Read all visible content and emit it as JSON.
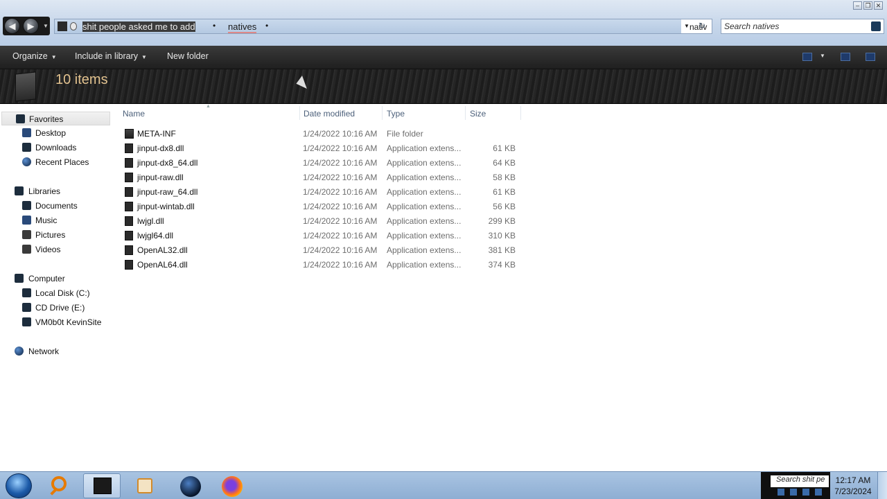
{
  "window": {
    "controls": {
      "minimize": "–",
      "restore": "❐",
      "close": "✕"
    }
  },
  "address": {
    "crumbs": [
      "shit people asked me to add",
      "natives"
    ],
    "end_text": "nativ",
    "refresh_icon": "refresh-icon"
  },
  "search": {
    "placeholder": "Search natives"
  },
  "toolbar": {
    "organize": "Organize",
    "include": "Include in library",
    "new_folder": "New folder"
  },
  "header": {
    "item_count": "10 items"
  },
  "nav": {
    "favorites": {
      "label": "Favorites",
      "items": [
        "Desktop",
        "Downloads",
        "Recent Places"
      ]
    },
    "libraries": {
      "label": "Libraries",
      "items": [
        "Documents",
        "Music",
        "Pictures",
        "Videos"
      ]
    },
    "computer": {
      "label": "Computer",
      "items": [
        "Local Disk (C:)",
        "CD Drive (E:)",
        "VM0b0t KevinSite"
      ]
    },
    "network": {
      "label": "Network"
    }
  },
  "columns": {
    "name": "Name",
    "date": "Date modified",
    "type": "Type",
    "size": "Size"
  },
  "files": [
    {
      "name": "META-INF",
      "date": "1/24/2022 10:16 AM",
      "type": "File folder",
      "size": ""
    },
    {
      "name": "jinput-dx8.dll",
      "date": "1/24/2022 10:16 AM",
      "type": "Application extens...",
      "size": "61 KB"
    },
    {
      "name": "jinput-dx8_64.dll",
      "date": "1/24/2022 10:16 AM",
      "type": "Application extens...",
      "size": "64 KB"
    },
    {
      "name": "jinput-raw.dll",
      "date": "1/24/2022 10:16 AM",
      "type": "Application extens...",
      "size": "58 KB"
    },
    {
      "name": "jinput-raw_64.dll",
      "date": "1/24/2022 10:16 AM",
      "type": "Application extens...",
      "size": "61 KB"
    },
    {
      "name": "jinput-wintab.dll",
      "date": "1/24/2022 10:16 AM",
      "type": "Application extens...",
      "size": "56 KB"
    },
    {
      "name": "lwjgl.dll",
      "date": "1/24/2022 10:16 AM",
      "type": "Application extens...",
      "size": "299 KB"
    },
    {
      "name": "lwjgl64.dll",
      "date": "1/24/2022 10:16 AM",
      "type": "Application extens...",
      "size": "310 KB"
    },
    {
      "name": "OpenAL32.dll",
      "date": "1/24/2022 10:16 AM",
      "type": "Application extens...",
      "size": "381 KB"
    },
    {
      "name": "OpenAL64.dll",
      "date": "1/24/2022 10:16 AM",
      "type": "Application extens...",
      "size": "374 KB"
    }
  ],
  "taskbar": {
    "tray_search": "Search shit pe",
    "time": "12:17 AM",
    "date": "7/23/2024"
  },
  "colors": {
    "accent": "#e2c28f",
    "toolbar_bg": "#2a2a2a",
    "taskbar_bg": "#a9c4e2"
  }
}
